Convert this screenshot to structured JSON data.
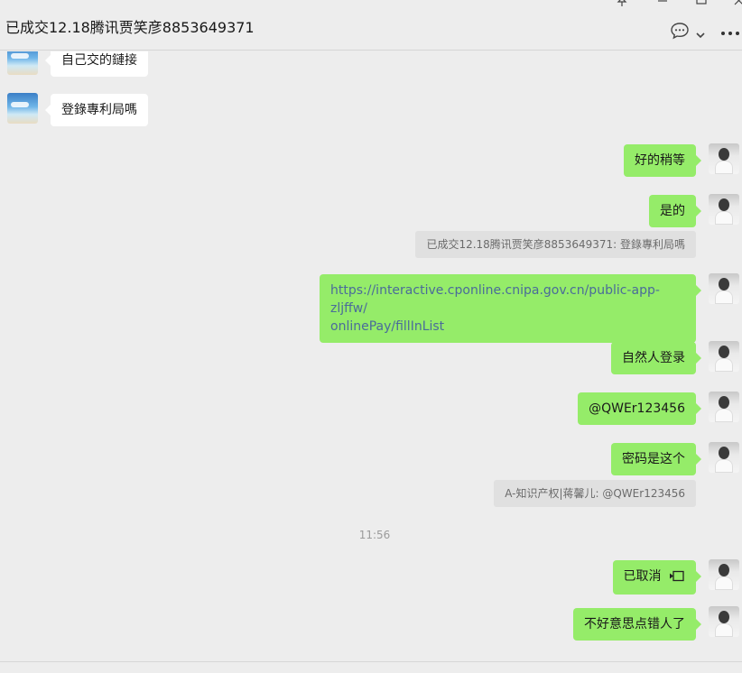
{
  "header": {
    "title": "已成交12.18腾讯贾笑彦8853649371",
    "pin_icon": "pin-icon",
    "minimize_icon": "minimize-icon",
    "maximize_icon": "maximize-icon",
    "close_icon": "close-icon",
    "chat_info_icon": "speech-bubble-icon",
    "dropdown_icon": "chevron-down-icon",
    "more_icon": "more-dots-icon"
  },
  "messages": [
    {
      "side": "other",
      "text": "自己交的鏈接"
    },
    {
      "side": "other",
      "text": "登錄專利局嗎"
    },
    {
      "side": "me",
      "text": "好的稍等"
    },
    {
      "side": "me",
      "text": "是的"
    },
    {
      "quote": "已成交12.18腾讯贾笑彦8853649371: 登錄專利局嗎"
    },
    {
      "side": "me",
      "text": "https://interactive.cponline.cnipa.gov.cn/public-app-zljffw/onlinePay/fillInList",
      "line1": "https://interactive.cponline.cnipa.gov.cn/public-app-zljffw/",
      "line2": "onlinePay/fillInList"
    },
    {
      "side": "me",
      "text": "自然人登录"
    },
    {
      "side": "me",
      "text": "@QWEr123456"
    },
    {
      "side": "me",
      "text": "密码是这个"
    },
    {
      "quote": "A-知识产权|蒋馨儿: @QWEr123456"
    },
    {
      "time": "11:56"
    },
    {
      "side": "me",
      "text": "已取消",
      "icon": "video-call-icon"
    },
    {
      "side": "me",
      "text": "不好意思点错人了"
    }
  ],
  "colors": {
    "background": "#ededed",
    "my_bubble": "#95ec69",
    "other_bubble": "#ffffff",
    "link_text": "#4a6b9a"
  }
}
